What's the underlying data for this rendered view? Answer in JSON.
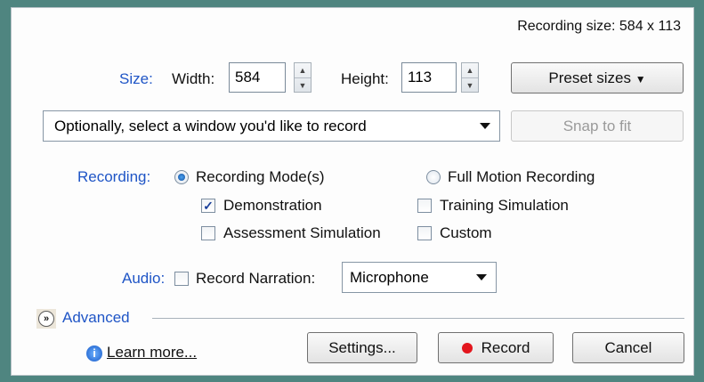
{
  "recording_size_text": "Recording size: 584 x 113",
  "size": {
    "label": "Size:",
    "width_label": "Width:",
    "width_value": "584",
    "height_label": "Height:",
    "height_value": "113",
    "preset_button": "Preset sizes"
  },
  "window_select": {
    "value": "Optionally, select a window you'd like to record",
    "snap_button": "Snap to fit"
  },
  "recording": {
    "label": "Recording:",
    "mode_recording": "Recording Mode(s)",
    "mode_full_motion": "Full Motion Recording",
    "options": {
      "demonstration": "Demonstration",
      "training_simulation": "Training Simulation",
      "assessment_simulation": "Assessment Simulation",
      "custom": "Custom"
    }
  },
  "audio": {
    "label": "Audio:",
    "record_narration": "Record Narration:",
    "device": "Microphone"
  },
  "advanced": {
    "label": "Advanced"
  },
  "footer": {
    "learn_more": "Learn more...",
    "settings_button": "Settings...",
    "record_button": "Record",
    "cancel_button": "Cancel"
  },
  "colors": {
    "frame": "#4f8580",
    "label_blue": "#1f55c6",
    "record_dot": "#e3161d"
  }
}
